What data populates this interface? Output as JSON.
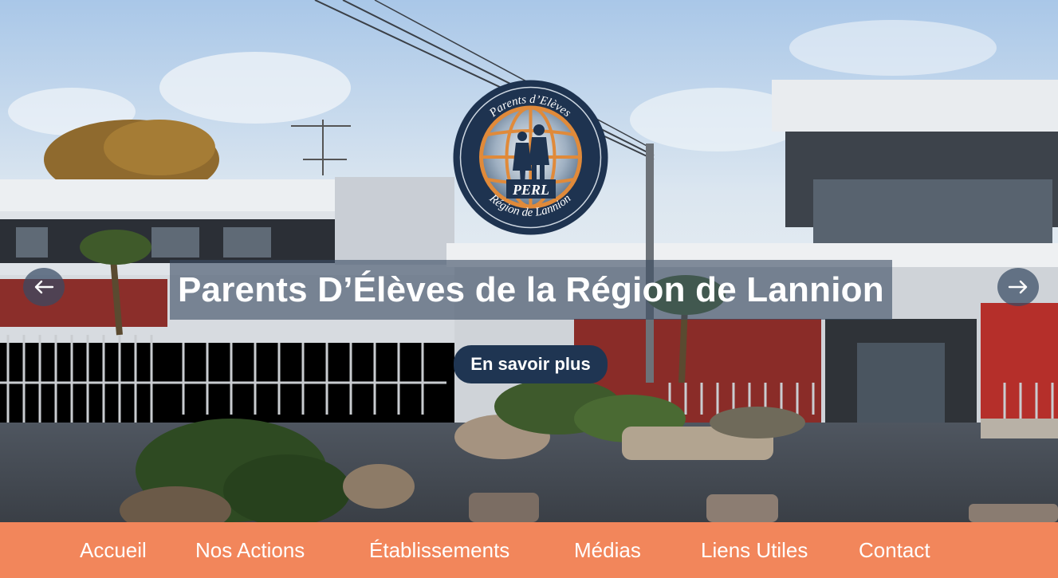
{
  "hero": {
    "title": "Parents D’Élèves de la Région de Lannion",
    "cta_label": "En savoir plus",
    "logo": {
      "top_text": "Parents d’Elèves",
      "center_text": "PERL",
      "bottom_text": "Région de Lannion"
    }
  },
  "carousel": {
    "prev_icon": "arrow-left-icon",
    "next_icon": "arrow-right-icon"
  },
  "nav": {
    "items": [
      {
        "label": "Accueil"
      },
      {
        "label": "Nos Actions"
      },
      {
        "label": "Établissements"
      },
      {
        "label": "Médias"
      },
      {
        "label": "Liens Utiles"
      },
      {
        "label": "Contact"
      }
    ]
  },
  "colors": {
    "nav_background": "#f2865b",
    "cta_background": "#1f3552",
    "logo_ring": "#1e3350",
    "logo_accent": "#e08a3a"
  }
}
